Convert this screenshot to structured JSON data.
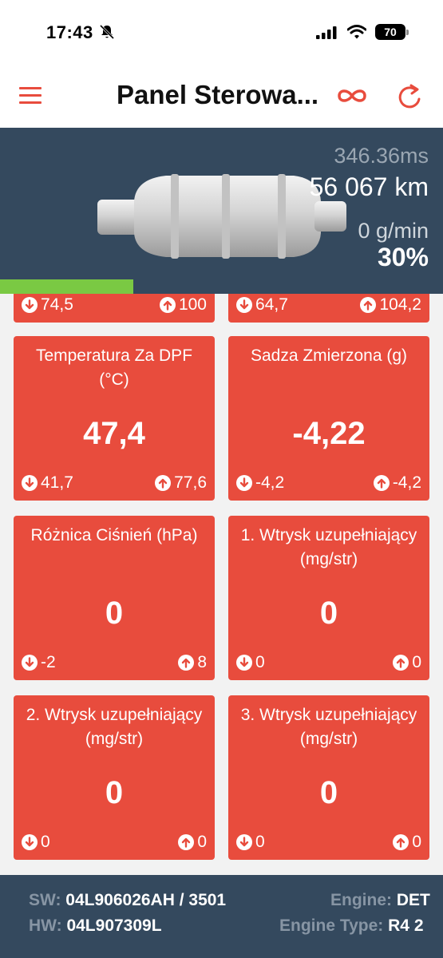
{
  "status": {
    "time": "17:43",
    "battery": "70"
  },
  "nav": {
    "title": "Panel Sterowa..."
  },
  "header": {
    "ms": "346.36ms",
    "km": "56 067 km",
    "gmin": "0 g/min",
    "percent": "30%",
    "progress_fraction": 0.3
  },
  "cards": [
    {
      "title": "",
      "value": "",
      "min": "74,5",
      "max": "100"
    },
    {
      "title": "",
      "value": "",
      "min": "64,7",
      "max": "104,2"
    },
    {
      "title": "Temperatura Za DPF (°C)",
      "value": "47,4",
      "min": "41,7",
      "max": "77,6"
    },
    {
      "title": "Sadza Zmierzona (g)",
      "value": "-4,22",
      "min": "-4,2",
      "max": "-4,2"
    },
    {
      "title": "Różnica Ciśnień (hPa)",
      "value": "0",
      "min": "-2",
      "max": "8"
    },
    {
      "title": "1. Wtrysk uzupełniający (mg/str)",
      "value": "0",
      "min": "0",
      "max": "0"
    },
    {
      "title": "2. Wtrysk uzupełniający (mg/str)",
      "value": "0",
      "min": "0",
      "max": "0"
    },
    {
      "title": "3. Wtrysk uzupełniający (mg/str)",
      "value": "0",
      "min": "0",
      "max": "0"
    }
  ],
  "footer": {
    "sw_label": "SW:",
    "sw_value": "04L906026AH / 3501",
    "hw_label": "HW:",
    "hw_value": "04L907309L",
    "engine_label": "Engine:",
    "engine_value": "DET",
    "engine_type_label": "Engine Type:",
    "engine_type_value": "R4 2"
  },
  "colors": {
    "accent": "#e84c3d",
    "header": "#34495e",
    "progress": "#7ac943"
  }
}
